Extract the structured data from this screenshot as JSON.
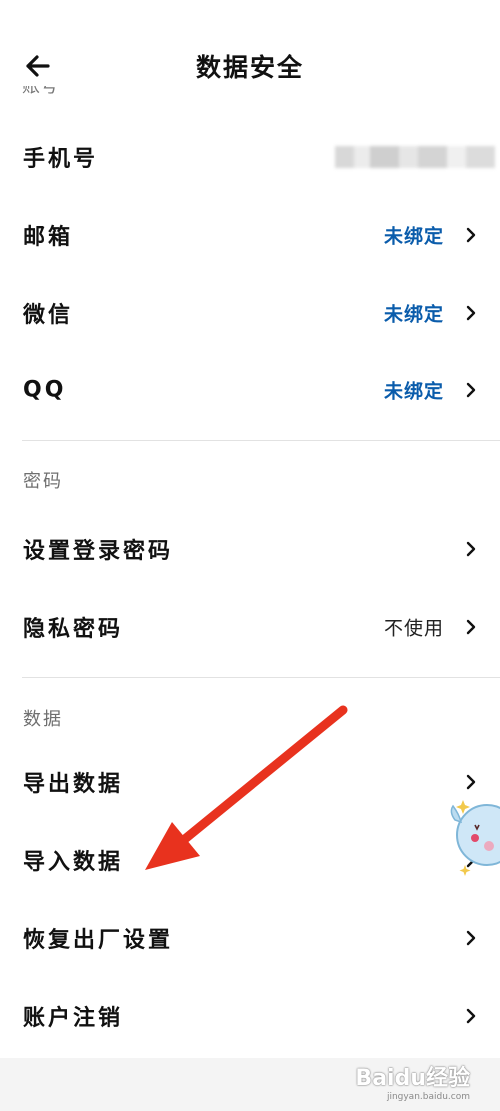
{
  "header": {
    "title": "数据安全",
    "back_icon": "arrow-left-icon",
    "clipped_section_label": "账号"
  },
  "account": {
    "rows": [
      {
        "label": "手机号",
        "value": "",
        "redacted": true
      },
      {
        "label": "邮箱",
        "value": "未绑定"
      },
      {
        "label": "微信",
        "value": "未绑定"
      },
      {
        "label": "QQ",
        "value": "未绑定"
      }
    ]
  },
  "password": {
    "section_label": "密码",
    "rows": [
      {
        "label": "设置登录密码",
        "value": ""
      },
      {
        "label": "隐私密码",
        "value": "不使用"
      }
    ]
  },
  "data_section": {
    "section_label": "数据",
    "rows": [
      {
        "label": "导出数据"
      },
      {
        "label": "导入数据"
      },
      {
        "label": "恢复出厂设置"
      },
      {
        "label": "账户注销"
      }
    ]
  },
  "annotation": {
    "arrow_color": "#e8321e"
  },
  "colors": {
    "link_value": "#0a5cab",
    "section_label": "#6f6f6f"
  },
  "watermark": {
    "brand": "Baidu经验",
    "url": "jingyan.baidu.com"
  }
}
